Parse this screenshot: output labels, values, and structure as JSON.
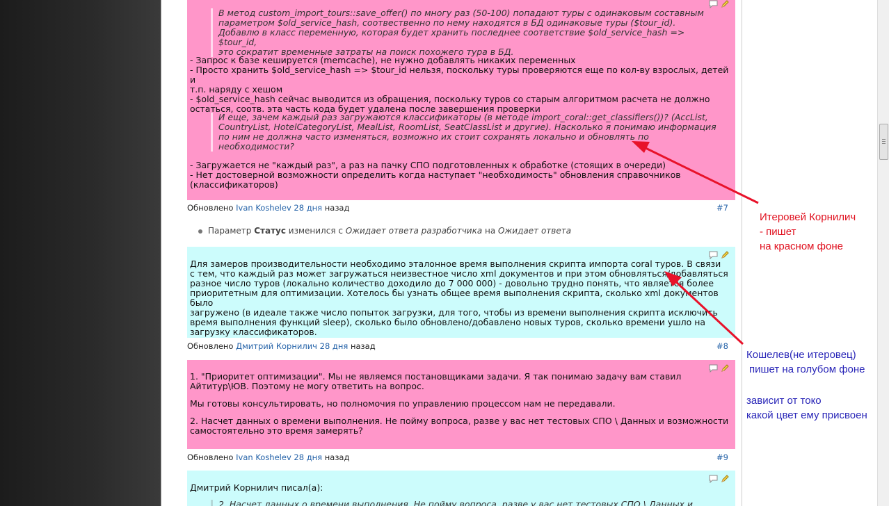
{
  "note_top": {
    "quote1": [
      "В метод custom_import_tours::save_offer() по многу раз (50-100) попадают туры с одинаковым составным",
      "параметром $old_service_hash, соотвественно по нему находятся в БД одинаковые туры ($tour_id).",
      "Добавлю в класс переменную, которая будет хранить последнее соответствие $old_service_hash => $tour_id,",
      "это сократит временные затраты на поиск похожего тура в БД."
    ],
    "answer1": [
      "- Запрос к базе кешируется (memcache), не нужно добавлять никаких переменных",
      "- Просто хранить $old_service_hash => $tour_id нельзя, поскольку туры проверяются еще по кол-ву взрослых, детей и",
      "т.п. наряду с хешом",
      "- $old_service_hash сейчас выводится из обращения, поскольку туров со старым алгоритмом расчета не должно",
      "остаться, соотв. эта часть кода будет удалена после завершения проверки"
    ],
    "quote2": [
      "И еще, зачем каждый раз загружаются классификаторы (в методе import_coral::get_classifiers())? (AccList,",
      "CountryList, HotelCategoryList, MealList, RoomList, SeatClassList и другие). Насколько я понимаю информация",
      "по ним не должна часто изменяться, возможно их стоит сохранять локально и обновлять по",
      "необходимости?"
    ],
    "answer2": [
      "- Загружается не \"каждый раз\", а раз на пачку СПО подготовленных к обработке (стоящих в очереди)",
      "- Нет достоверной возможности определить когда наступает \"необходимость\" обновления справочников",
      "(классификаторов)"
    ]
  },
  "meta7": {
    "prefix": "Обновлено",
    "author": "Ivan Koshelev",
    "ago": "28 дня",
    "suffix": "назад",
    "num": "#7"
  },
  "journal": {
    "prefix": "Параметр",
    "field": "Статус",
    "mid": "изменился с",
    "from": "Ожидает ответа разработчика",
    "on": "на",
    "to": "Ожидает ответа"
  },
  "note8": [
    "Для замеров производительности необходимо эталонное время выполнения скрипта импорта coral туров. В связи",
    "с тем, что каждый раз может загружаться неизвестное число xml документов и при этом обновляться/добавляться",
    "разное число туров (локально количество доходило до 7 000 000) - довольно трудно понять, что является более",
    "приоритетным для оптимизации. Хотелось бы узнать общее время выполнения скрипта, сколько xml документов было",
    "загружено (в идеале также число попыток загрузки, для того, чтобы из времени выполнения скрипта исключить",
    "время выполнения функций sleep), сколько было обновлено/добавлено новых туров, сколько времени ушло на",
    "загрузку классификаторов."
  ],
  "meta8": {
    "prefix": "Обновлено",
    "author": "Дмитрий Корнилич",
    "ago": "28 дня",
    "suffix": "назад",
    "num": "#8"
  },
  "note9": {
    "p1": [
      "1. \"Приоритет оптимизации\". Мы не являемся постановщиками задачи. Я так понимаю задачу вам ставил",
      "Айтитур\\ЮВ. Поэтому не могу ответить на вопрос."
    ],
    "p2": "Мы готовы консультировать, но полномочия по управлению процессом нам не передавали.",
    "p3": [
      "2. Насчет данных о времени выполнения. Не пойму вопроса, разве у вас нет тестовых СПО \\ Данных и возможности",
      "самостоятельно это время замерять?"
    ]
  },
  "meta9": {
    "prefix": "Обновлено",
    "author": "Ivan Koshelev",
    "ago": "28 дня",
    "suffix": "назад",
    "num": "#9"
  },
  "note10": {
    "header": "Дмитрий Корнилич писал(а):",
    "quote": "2. Насчет данных о времени выполнения. Не пойму вопроса, разве у вас нет тестовых СПО \\ Данных и"
  },
  "annotations": {
    "red": [
      "Итеровей Корнилич",
      "- пишет",
      "на красном фоне"
    ],
    "blue1": [
      "Кошелев(не итеровец)",
      "пишет на голубом фоне"
    ],
    "blue2": [
      "зависит от токо",
      "какой цвет ему присвоен"
    ]
  },
  "colors": {
    "pink": "#ff96c9",
    "cyan": "#ccfcfc",
    "link": "#2462a8",
    "annotation_red": "#e0101e",
    "annotation_blue": "#2a27b8",
    "arrow": "#e8122a"
  },
  "icons": [
    "quote-comment-icon",
    "edit-pencil-icon"
  ]
}
